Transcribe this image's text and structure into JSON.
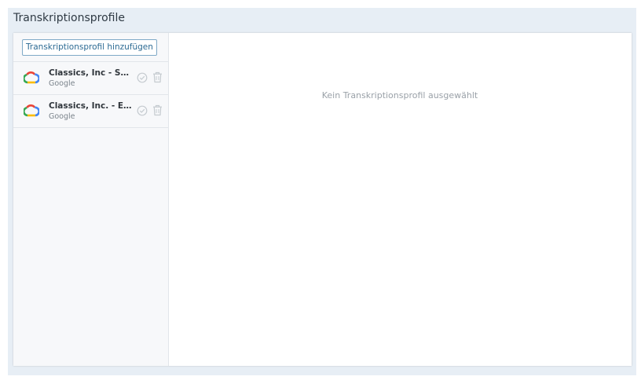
{
  "page": {
    "title": "Transkriptionsprofile"
  },
  "sidebar": {
    "add_label": "Transkriptionsprofil hinzufügen",
    "items": [
      {
        "name": "Classics, Inc - Spanish",
        "provider": "Google",
        "logo": "google-cloud-icon"
      },
      {
        "name": "Classics, Inc. - English",
        "provider": "Google",
        "logo": "google-cloud-icon"
      }
    ]
  },
  "main": {
    "empty_text": "Kein Transkriptionsprofil ausgewählt"
  },
  "colors": {
    "frame": "#e7eef5",
    "accent": "#2c6a93",
    "google_blue": "#4285f4",
    "google_red": "#ea4335",
    "google_yellow": "#fbbc05",
    "google_green": "#34a853"
  }
}
